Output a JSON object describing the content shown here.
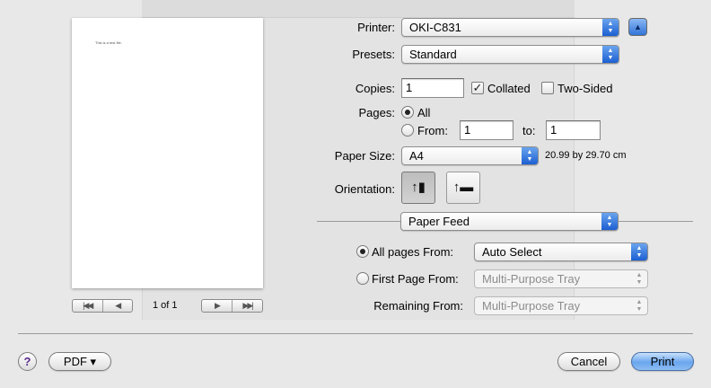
{
  "preview": {
    "page_text": "This is a test file.",
    "page_count": "1 of 1"
  },
  "printer": {
    "label": "Printer:",
    "value": "OKI-C831"
  },
  "presets": {
    "label": "Presets:",
    "value": "Standard"
  },
  "copies": {
    "label": "Copies:",
    "value": "1",
    "collated_label": "Collated",
    "collated_checked": true,
    "two_sided_label": "Two-Sided",
    "two_sided_checked": false
  },
  "pages": {
    "label": "Pages:",
    "all_label": "All",
    "from_label": "From:",
    "from_value": "1",
    "to_label": "to:",
    "to_value": "1",
    "selected": "all"
  },
  "paper_size": {
    "label": "Paper Size:",
    "value": "A4",
    "dimensions": "20.99 by 29.70 cm"
  },
  "orientation": {
    "label": "Orientation:",
    "selected": "portrait"
  },
  "section": {
    "value": "Paper Feed"
  },
  "paper_feed": {
    "all_pages_label": "All pages From:",
    "all_pages_value": "Auto Select",
    "first_page_label": "First Page From:",
    "first_page_value": "Multi-Purpose Tray",
    "remaining_label": "Remaining From:",
    "remaining_value": "Multi-Purpose Tray",
    "selected": "all_pages"
  },
  "footer": {
    "help": "?",
    "pdf": "PDF ▾",
    "cancel": "Cancel",
    "print": "Print"
  }
}
